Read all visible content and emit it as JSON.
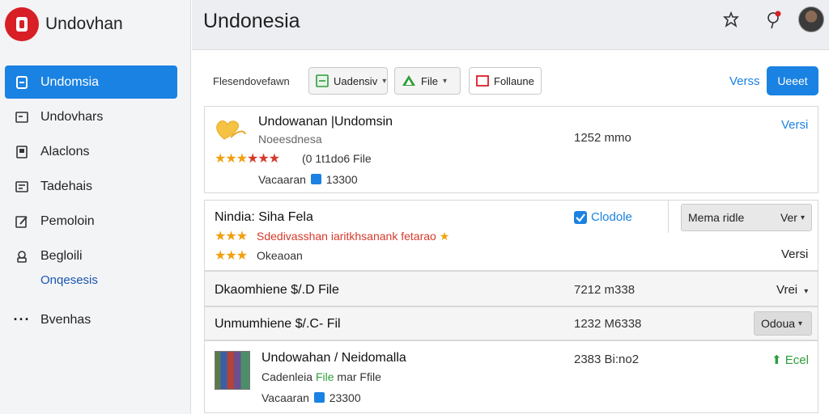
{
  "app": {
    "name": "Undovhan"
  },
  "sidebar": {
    "items": [
      {
        "label": "Undomsia",
        "icon": "document-icon",
        "active": true
      },
      {
        "label": "Undovhars",
        "icon": "folder-icon"
      },
      {
        "label": "Alaclons",
        "icon": "page-icon"
      },
      {
        "label": "Tadehais",
        "icon": "inbox-icon"
      },
      {
        "label": "Pemoloin",
        "icon": "edit-icon"
      },
      {
        "label": "Begloili",
        "icon": "settings-icon"
      }
    ],
    "sub_item": "Onqesesis",
    "more_item": {
      "label": "Bvenhas",
      "icon": "more-icon"
    }
  },
  "header": {
    "title": "Undonesia"
  },
  "toolbar": {
    "label": "Flesendovefawn",
    "btn1": "Uadensiv",
    "btn2": "File",
    "btn3": "Follaune",
    "versions_link": "Verss",
    "primary_button": "Ueeet"
  },
  "items": [
    {
      "title": "Undowanan |Undomsin",
      "subtitle": "Noeesdnesa",
      "rating": "(0 1t1do6 File",
      "price_prefix": "Vacaaran",
      "price": "13300",
      "meta": "1252 mmo",
      "action": "Versi"
    },
    {
      "title": "Nindia: Siha Fela",
      "subtitle": "Sdedivasshan iaritkhsanank fetarao",
      "rating": "Okeaoan",
      "checkbox_label": "Clodole",
      "select_label": "Mema ridle",
      "select_value": "Ver",
      "action": "Versi"
    },
    {
      "title": "Dkaomhiene $/.D File",
      "meta": "7212 m338",
      "action": "Vrei"
    },
    {
      "title": "Unmumhiene $/.C- Fil",
      "meta": "1232 M6338",
      "select_value": "Odoua"
    },
    {
      "title": "Undowahan / Neidomalla",
      "subtitle_a": "Cadenleia",
      "subtitle_b": "File",
      "subtitle_c": "mar Ffile",
      "price_prefix": "Vacaaran",
      "price": "23300",
      "meta": "2383 Bi:no2",
      "action": "Ecel"
    }
  ],
  "colors": {
    "accent": "#1a82e2",
    "brand": "#d81f26",
    "star": "#f0a10e",
    "star_red": "#d63a2b",
    "success": "#2e9d3a"
  }
}
